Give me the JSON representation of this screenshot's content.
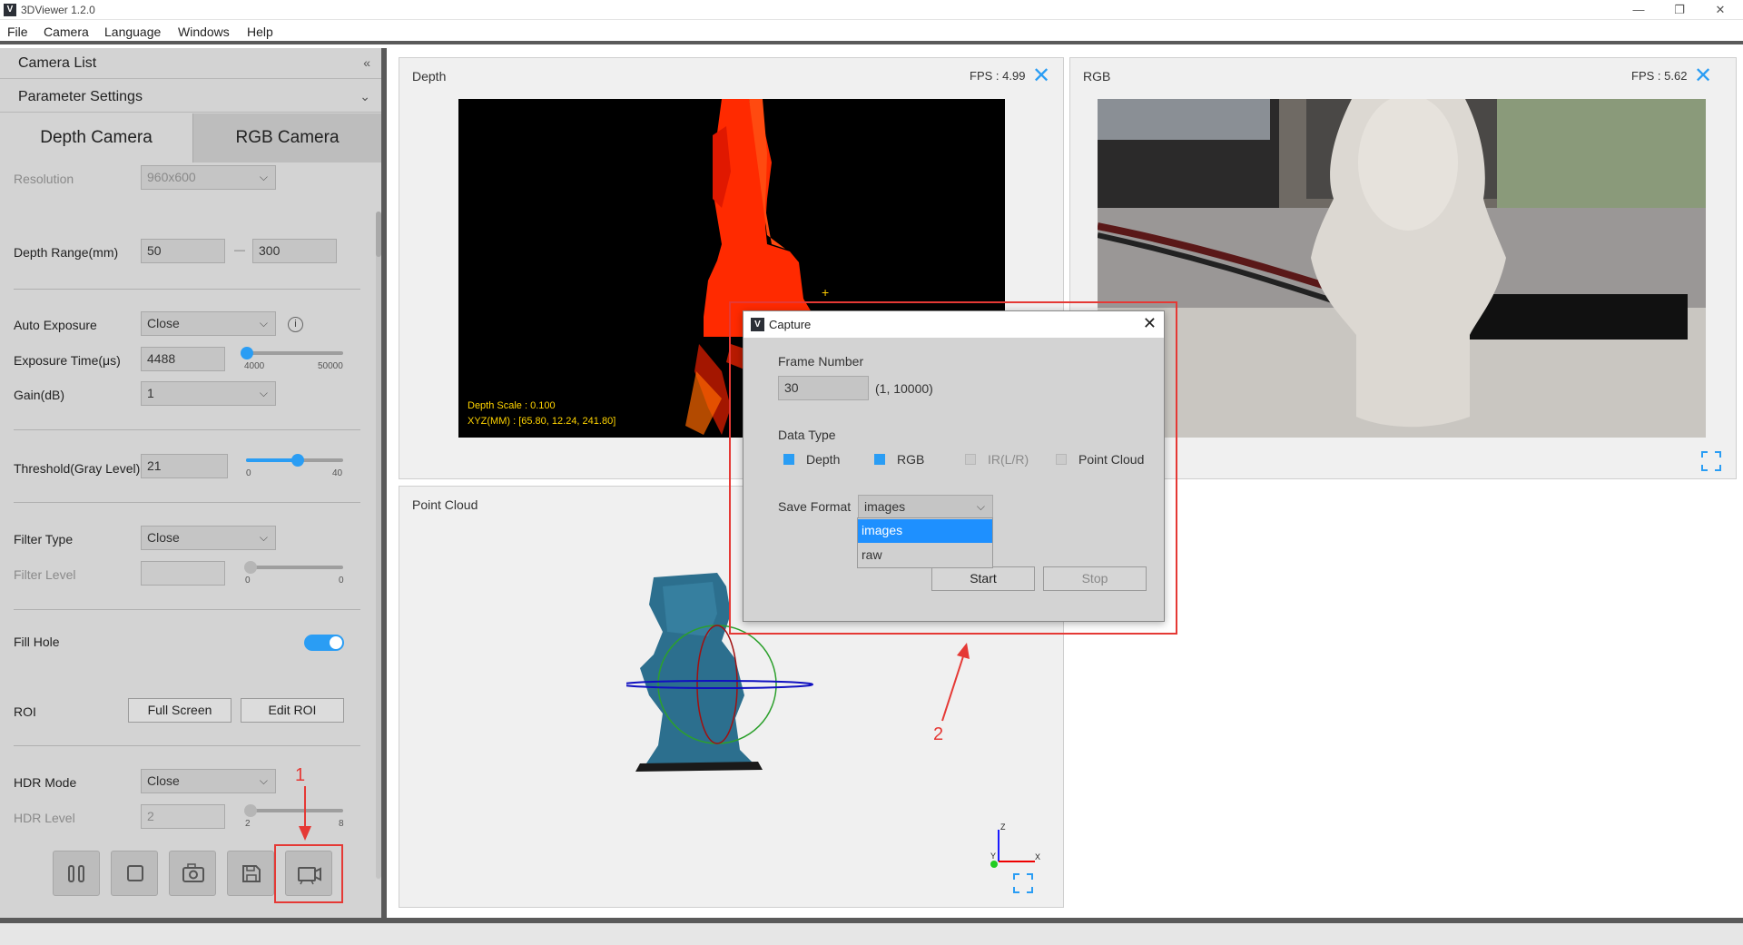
{
  "window": {
    "title": "3DViewer 1.2.0",
    "icon_letter": "V"
  },
  "menu": [
    "File",
    "Camera",
    "Language",
    "Windows",
    "Help"
  ],
  "left": {
    "camera_list": "Camera List",
    "param_settings": "Parameter Settings",
    "tabs": [
      "Depth Camera",
      "RGB Camera"
    ],
    "resolution": {
      "label": "Resolution",
      "value": "960x600"
    },
    "depth_range": {
      "label": "Depth Range(mm)",
      "min": "50",
      "max": "300",
      "sep": "—"
    },
    "auto_exposure": {
      "label": "Auto Exposure",
      "value": "Close"
    },
    "exposure_time": {
      "label": "Exposure Time(μs)",
      "value": "4488",
      "tick_min": "4000",
      "tick_max": "50000",
      "level": 0.01
    },
    "gain": {
      "label": "Gain(dB)",
      "value": "1"
    },
    "threshold": {
      "label": "Threshold(Gray Level)",
      "value": "21",
      "tick_min": "0",
      "tick_max": "40",
      "level": 0.525
    },
    "filter_type": {
      "label": "Filter Type",
      "value": "Close"
    },
    "filter_level": {
      "label": "Filter Level",
      "value": "",
      "tick_min": "0",
      "tick_max": "0"
    },
    "fill_hole": {
      "label": "Fill Hole",
      "on": true
    },
    "roi": {
      "label": "ROI",
      "full_screen": "Full Screen",
      "edit_roi": "Edit ROI"
    },
    "hdr_mode": {
      "label": "HDR Mode",
      "value": "Close"
    },
    "hdr_level": {
      "label": "HDR Level",
      "value": "2",
      "tick_min": "2",
      "tick_max": "8"
    }
  },
  "views": {
    "depth": {
      "title": "Depth",
      "fps": "FPS : 4.99",
      "depth_scale": "Depth Scale : 0.100",
      "xyz": "XYZ(MM) : [65.80, 12.24, 241.80]"
    },
    "rgb": {
      "title": "RGB",
      "fps": "FPS : 5.62"
    },
    "point_cloud": {
      "title": "Point Cloud",
      "axis_x": "X",
      "axis_y": "Y",
      "axis_z": "Z"
    }
  },
  "dialog": {
    "title": "Capture",
    "frame_number_label": "Frame Number",
    "frame_number_value": "30",
    "frame_range": "(1, 10000)",
    "data_type_label": "Data Type",
    "data_types": [
      {
        "label": "Depth",
        "checked": true
      },
      {
        "label": "RGB",
        "checked": true
      },
      {
        "label": "IR(L/R)",
        "checked": false
      },
      {
        "label": "Point Cloud",
        "checked": false
      }
    ],
    "save_format_label": "Save Format",
    "save_format_value": "images",
    "save_format_options": [
      "images",
      "raw"
    ],
    "start": "Start",
    "stop": "Stop"
  },
  "annotations": {
    "one": "1",
    "two": "2"
  },
  "colors": {
    "accent": "#2a9df4",
    "annotation": "#e53935"
  }
}
